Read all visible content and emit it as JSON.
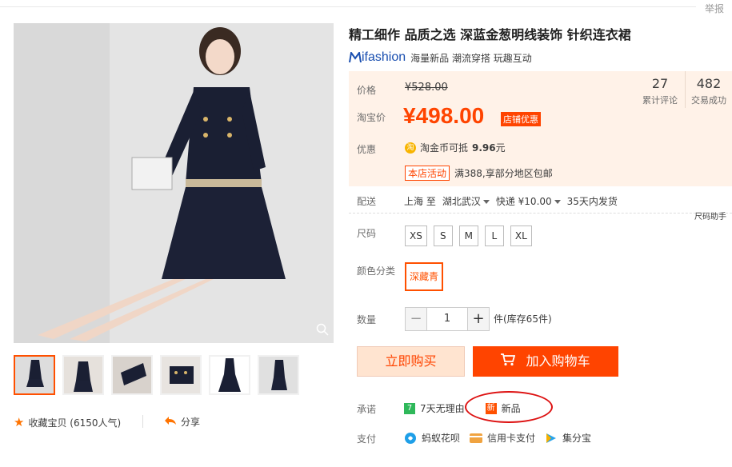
{
  "header": {
    "report": "举报"
  },
  "product": {
    "title": "精工细作 品质之选 深蓝金葱明线装饰 针织连衣裙",
    "brand_logo": "ifashion",
    "brand_tags": "海量新品  潮流穿搭  玩趣互动"
  },
  "price": {
    "label": "价格",
    "old": "¥528.00",
    "taobao_label": "淘宝价",
    "new": "¥498.00",
    "shop_tag": "店铺优惠",
    "reviews_count": "27",
    "reviews_label": "累计评论",
    "sales_count": "482",
    "sales_label": "交易成功",
    "promo_label": "优惠",
    "coin_text": "淘金币可抵",
    "coin_value": "9.96",
    "coin_unit": "元",
    "activity_tag": "本店活动",
    "activity_text": "满388,享部分地区包邮"
  },
  "shipping": {
    "label": "配送",
    "from": "上海 至",
    "to": "湖北武汉",
    "express": "快递 ¥10.00",
    "time": "35天内发货",
    "size_help": "尺码助手"
  },
  "size": {
    "label": "尺码",
    "options": [
      "XS",
      "S",
      "M",
      "L",
      "XL"
    ]
  },
  "color": {
    "label": "颜色分类",
    "selected": "深藏青"
  },
  "quantity": {
    "label": "数量",
    "minus": "−",
    "value": "1",
    "plus": "+",
    "stock": "件(库存65件)"
  },
  "actions": {
    "buy_now": "立即购买",
    "add_cart": "加入购物车"
  },
  "promise": {
    "label": "承诺",
    "return": "7天无理由",
    "new": "新品"
  },
  "payment": {
    "label": "支付",
    "items": [
      "蚂蚁花呗",
      "信用卡支付",
      "集分宝"
    ]
  },
  "footer": {
    "favorite": "收藏宝贝 (6150人气)",
    "share": "分享"
  },
  "colors": {
    "accent": "#ff4400",
    "price_bg": "#fff2e8",
    "brand": "#1a4fb0"
  }
}
